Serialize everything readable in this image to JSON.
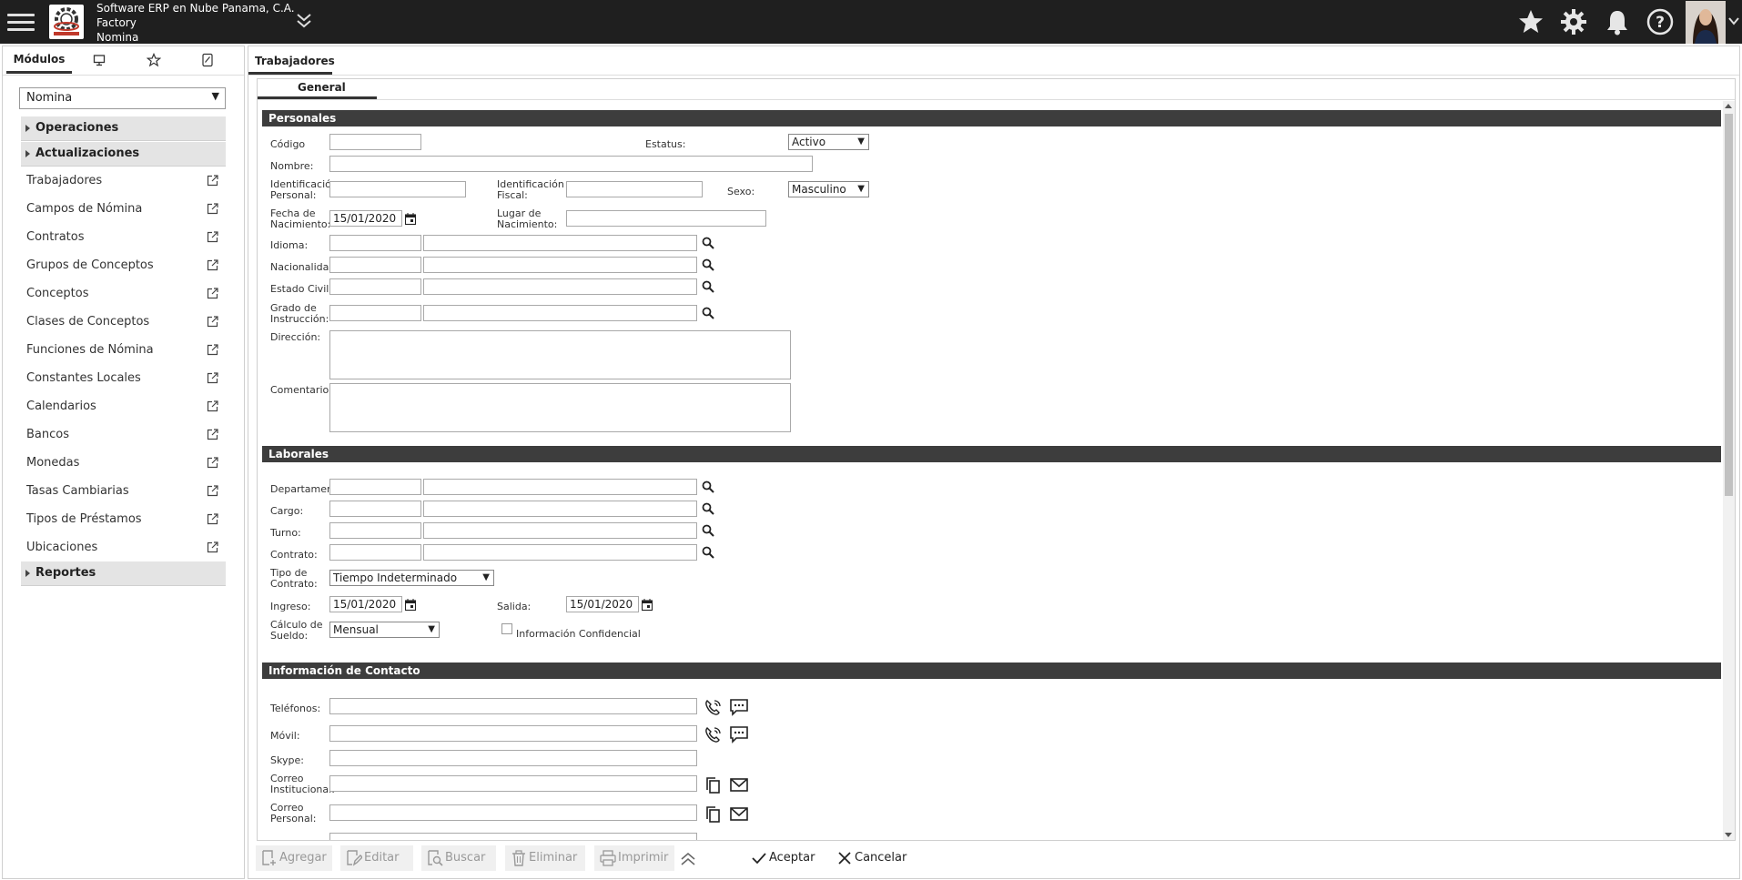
{
  "header": {
    "company": "Software ERP en Nube Panama, C.A.",
    "site": "Factory",
    "module": "Nomina"
  },
  "sidebar": {
    "tab_modulos": "Módulos",
    "module_select": "Nomina",
    "groups": {
      "operaciones": "Operaciones",
      "actualizaciones": "Actualizaciones",
      "reportes": "Reportes"
    },
    "items": [
      "Trabajadores",
      "Campos de Nómina",
      "Contratos",
      "Grupos de Conceptos",
      "Conceptos",
      "Clases de Conceptos",
      "Funciones de Nómina",
      "Constantes Locales",
      "Calendarios",
      "Bancos",
      "Monedas",
      "Tasas Cambiarias",
      "Tipos de Préstamos",
      "Ubicaciones"
    ]
  },
  "main": {
    "tab": "Trabajadores",
    "subtab": "General",
    "sections": {
      "personales": "Personales",
      "laborales": "Laborales",
      "contacto": "Información de Contacto"
    }
  },
  "form": {
    "codigo": "Código",
    "estatus": "Estatus:",
    "estatus_value": "Activo",
    "nombre": "Nombre:",
    "id_personal_1": "Identificación",
    "id_personal_2": "Personal:",
    "id_fiscal_1": "Identificación",
    "id_fiscal_2": "Fiscal:",
    "sexo": "Sexo:",
    "sexo_value": "Masculino",
    "fecha_nac_1": "Fecha de",
    "fecha_nac_2": "Nacimiento:",
    "fecha_nac_value": "15/01/2020",
    "lugar_nac_1": "Lugar de",
    "lugar_nac_2": "Nacimiento:",
    "idioma": "Idioma:",
    "nacionalidad": "Nacionalidad:",
    "estado_civil": "Estado Civil:",
    "grado_1": "Grado de",
    "grado_2": "Instrucción:",
    "direccion": "Dirección:",
    "comentario": "Comentario:",
    "departamento": "Departamento",
    "cargo": "Cargo:",
    "turno": "Turno:",
    "contrato": "Contrato:",
    "tipo_contrato_1": "Tipo de",
    "tipo_contrato_2": "Contrato:",
    "tipo_contrato_value": "Tiempo Indeterminado",
    "ingreso": "Ingreso:",
    "ingreso_value": "15/01/2020",
    "salida": "Salida:",
    "salida_value": "15/01/2020",
    "calculo_1": "Cálculo de",
    "calculo_2": "Sueldo:",
    "calculo_value": "Mensual",
    "confidencial": "Información Confidencial",
    "telefonos": "Teléfonos:",
    "movil": "Móvil:",
    "skype": "Skype:",
    "correo_inst_1": "Correo",
    "correo_inst_2": "Institucional:",
    "correo_pers_1": "Correo",
    "correo_pers_2": "Personal:"
  },
  "toolbar": {
    "agregar": "Agregar",
    "editar": "Editar",
    "buscar": "Buscar",
    "eliminar": "Eliminar",
    "imprimir": "Imprimir",
    "aceptar": "Aceptar",
    "cancelar": "Cancelar"
  }
}
